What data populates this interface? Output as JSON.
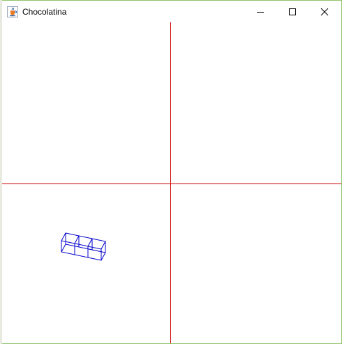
{
  "window": {
    "title": "Chocolatina",
    "controls": {
      "minimize": "minimize",
      "maximize": "maximize",
      "close": "close"
    },
    "app_icon": "java-cup-icon"
  },
  "colors": {
    "border": "#8fc36a",
    "axis": "#cc0000",
    "wireframe": "#0000cc"
  }
}
